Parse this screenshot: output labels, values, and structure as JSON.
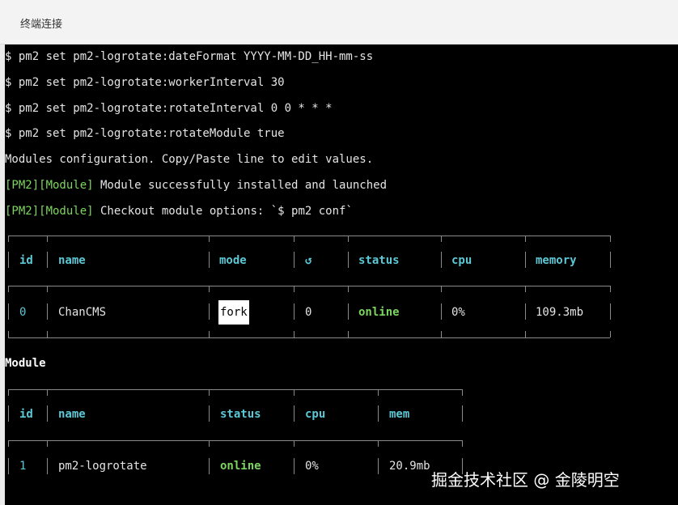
{
  "window": {
    "title": "终端连接"
  },
  "terminal": {
    "commands": [
      "$ pm2 set pm2-logrotate:dateFormat YYYY-MM-DD_HH-mm-ss",
      "$ pm2 set pm2-logrotate:workerInterval 30",
      "$ pm2 set pm2-logrotate:rotateInterval 0 0 * * *",
      "$ pm2 set pm2-logrotate:rotateModule true",
      "Modules configuration. Copy/Paste line to edit values."
    ],
    "pm2_lines": [
      {
        "tag": "[PM2][Module]",
        "text": " Module successfully installed and launched"
      },
      {
        "tag": "[PM2][Module]",
        "text": " Checkout module options: `$ pm2 conf`"
      }
    ],
    "process_table": {
      "headers": [
        "id",
        "name",
        "mode",
        "↺",
        "status",
        "cpu",
        "memory"
      ],
      "rows": [
        {
          "id": "0",
          "name": "ChanCMS",
          "mode": "fork",
          "restarts": "0",
          "status": "online",
          "cpu": "0%",
          "memory": "109.3mb"
        }
      ]
    },
    "module_heading": "Module",
    "module_table": {
      "headers": [
        "id",
        "name",
        "status",
        "cpu",
        "mem"
      ],
      "rows": [
        {
          "id": "1",
          "name": "pm2-logrotate",
          "status": "online",
          "cpu": "0%",
          "mem": "20.9mb"
        }
      ]
    }
  },
  "watermark": "掘金技术社区 @ 金陵明空"
}
